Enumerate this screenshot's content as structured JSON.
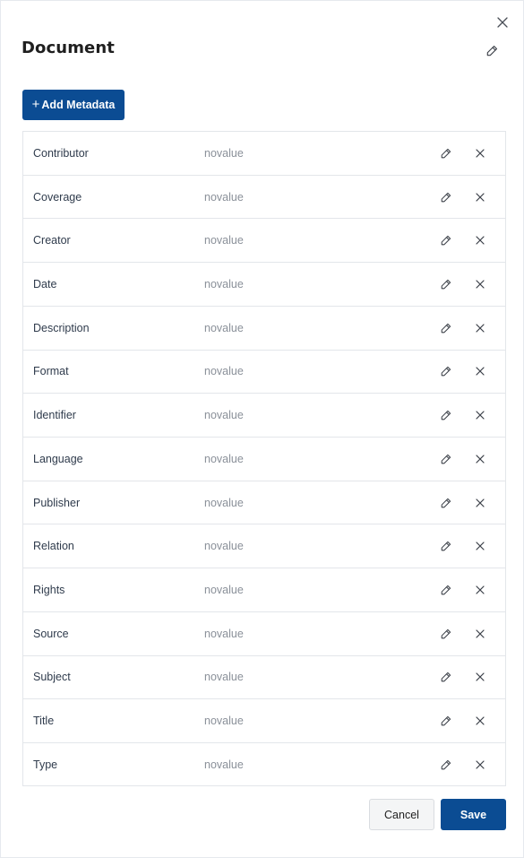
{
  "dialog": {
    "title": "Document",
    "add_button_plus": "+",
    "add_button_label": "Add Metadata",
    "cancel_label": "Cancel",
    "save_label": "Save",
    "icons": {
      "close": "close-icon",
      "title_edit": "pencil-icon",
      "row_edit": "pencil-icon",
      "row_delete": "close-icon"
    },
    "colors": {
      "primary": "#0b4c93",
      "value_text": "#8a9099",
      "label_text": "#2f3b4c"
    }
  },
  "metadata": {
    "rows": [
      {
        "label": "Contributor",
        "value": "novalue"
      },
      {
        "label": "Coverage",
        "value": "novalue"
      },
      {
        "label": "Creator",
        "value": "novalue"
      },
      {
        "label": "Date",
        "value": "novalue"
      },
      {
        "label": "Description",
        "value": "novalue"
      },
      {
        "label": "Format",
        "value": "novalue"
      },
      {
        "label": "Identifier",
        "value": "novalue"
      },
      {
        "label": "Language",
        "value": "novalue"
      },
      {
        "label": "Publisher",
        "value": "novalue"
      },
      {
        "label": "Relation",
        "value": "novalue"
      },
      {
        "label": "Rights",
        "value": "novalue"
      },
      {
        "label": "Source",
        "value": "novalue"
      },
      {
        "label": "Subject",
        "value": "novalue"
      },
      {
        "label": "Title",
        "value": "novalue"
      },
      {
        "label": "Type",
        "value": "novalue"
      }
    ]
  }
}
